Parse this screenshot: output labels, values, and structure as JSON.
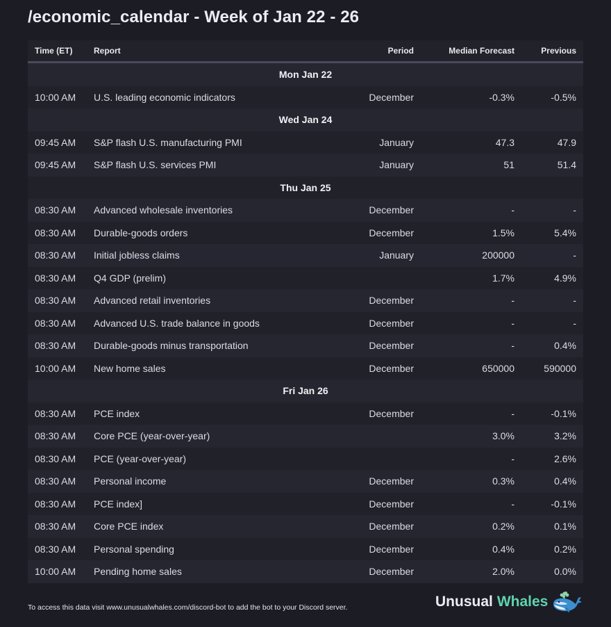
{
  "title": "/economic_calendar - Week of Jan 22 - 26",
  "table": {
    "headers": {
      "time": "Time (ET)",
      "report": "Report",
      "period": "Period",
      "forecast": "Median Forecast",
      "previous": "Previous"
    },
    "days": [
      {
        "label": "Mon Jan 22",
        "rows": [
          {
            "time": "10:00 AM",
            "report": "U.S. leading economic indicators",
            "period": "December",
            "forecast": "-0.3%",
            "previous": "-0.5%"
          }
        ]
      },
      {
        "label": "Wed Jan 24",
        "rows": [
          {
            "time": "09:45 AM",
            "report": "S&P flash U.S. manufacturing PMI",
            "period": "January",
            "forecast": "47.3",
            "previous": "47.9"
          },
          {
            "time": "09:45 AM",
            "report": "S&P flash U.S. services PMI",
            "period": "January",
            "forecast": "51",
            "previous": "51.4"
          }
        ]
      },
      {
        "label": "Thu Jan 25",
        "rows": [
          {
            "time": "08:30 AM",
            "report": "Advanced wholesale inventories",
            "period": "December",
            "forecast": "-",
            "previous": "-"
          },
          {
            "time": "08:30 AM",
            "report": "Durable-goods orders",
            "period": "December",
            "forecast": "1.5%",
            "previous": "5.4%"
          },
          {
            "time": "08:30 AM",
            "report": "Initial jobless claims",
            "period": "January",
            "forecast": "200000",
            "previous": "-"
          },
          {
            "time": "08:30 AM",
            "report": "Q4 GDP (prelim)",
            "period": "",
            "forecast": "1.7%",
            "previous": "4.9%"
          },
          {
            "time": "08:30 AM",
            "report": "Advanced retail inventories",
            "period": "December",
            "forecast": "-",
            "previous": "-"
          },
          {
            "time": "08:30 AM",
            "report": "Advanced U.S. trade balance in goods",
            "period": "December",
            "forecast": "-",
            "previous": "-"
          },
          {
            "time": "08:30 AM",
            "report": "Durable-goods minus transportation",
            "period": "December",
            "forecast": "-",
            "previous": "0.4%"
          },
          {
            "time": "10:00 AM",
            "report": "New home sales",
            "period": "December",
            "forecast": "650000",
            "previous": "590000"
          }
        ]
      },
      {
        "label": "Fri Jan 26",
        "rows": [
          {
            "time": "08:30 AM",
            "report": "PCE index",
            "period": "December",
            "forecast": "-",
            "previous": "-0.1%"
          },
          {
            "time": "08:30 AM",
            "report": "Core PCE (year-over-year)",
            "period": "",
            "forecast": "3.0%",
            "previous": "3.2%"
          },
          {
            "time": "08:30 AM",
            "report": "PCE (year-over-year)",
            "period": "",
            "forecast": "-",
            "previous": "2.6%"
          },
          {
            "time": "08:30 AM",
            "report": "Personal income",
            "period": "December",
            "forecast": "0.3%",
            "previous": "0.4%"
          },
          {
            "time": "08:30 AM",
            "report": "PCE index]",
            "period": "December",
            "forecast": "-",
            "previous": "-0.1%"
          },
          {
            "time": "08:30 AM",
            "report": "Core PCE index",
            "period": "December",
            "forecast": "0.2%",
            "previous": "0.1%"
          },
          {
            "time": "08:30 AM",
            "report": "Personal spending",
            "period": "December",
            "forecast": "0.4%",
            "previous": "0.2%"
          },
          {
            "time": "10:00 AM",
            "report": "Pending home sales",
            "period": "December",
            "forecast": "2.0%",
            "previous": "0.0%"
          }
        ]
      }
    ]
  },
  "footer": {
    "note": "To access this data visit www.unusualwhales.com/discord-bot to add the bot to your Discord server.",
    "brand_part1": "Unusual",
    "brand_part2": "Whales",
    "brand_icon": "whale-icon"
  },
  "colors": {
    "background": "#1c1c25",
    "header_bg": "#22222b",
    "separator": "#4b4a5e",
    "row_light": "#262631",
    "row_dark": "#21212a",
    "brand_accent": "#5fd4ae"
  }
}
